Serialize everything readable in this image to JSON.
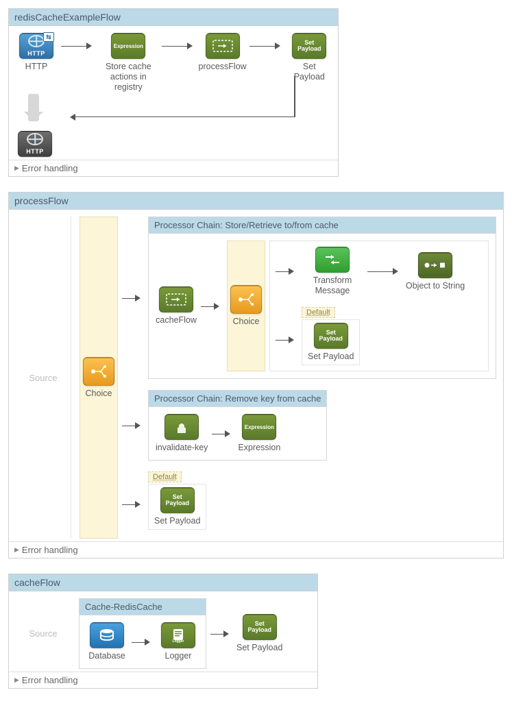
{
  "flows": {
    "redisCacheExample": {
      "title": "redisCacheExampleFlow",
      "nodes": {
        "http_in": "HTTP",
        "store_cache": "Store cache actions in registry",
        "processFlow": "processFlow",
        "setPayload": "Set Payload"
      },
      "error": "Error handling"
    },
    "processFlow": {
      "title": "processFlow",
      "source": "Source",
      "choice": "Choice",
      "chain1": {
        "title": "Processor Chain: Store/Retrieve to/from cache",
        "cacheFlow": "cacheFlow",
        "choice": "Choice",
        "transform": "Transform Message",
        "obj2str": "Object to String",
        "defaultTag": "Default",
        "setPayload": "Set Payload"
      },
      "chain2": {
        "title": "Processor Chain: Remove key from cache",
        "invalidate": "invalidate-key",
        "expression": "Expression"
      },
      "defaultTag": "Default",
      "setPayload": "Set Payload",
      "error": "Error handling"
    },
    "cacheFlow": {
      "title": "cacheFlow",
      "source": "Source",
      "scope": "Cache-RedisCache",
      "database": "Database",
      "logger": "Logger",
      "setPayload": "Set Payload",
      "error": "Error handling"
    }
  },
  "icon_text": {
    "http": "HTTP",
    "expression": "Expression",
    "set": "Set",
    "payload": "Payload",
    "logger": "Logger"
  }
}
